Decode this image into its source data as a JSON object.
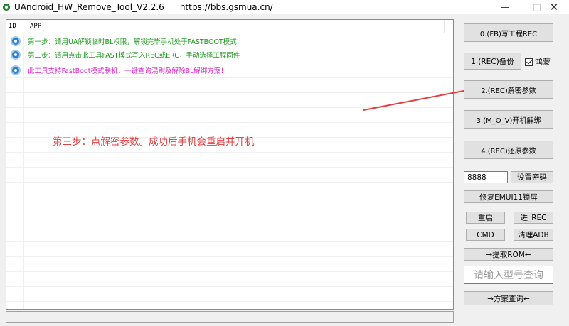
{
  "window": {
    "title": "UAndroid_HW_Remove_Tool_V2.2.6",
    "url": "https://bbs.gsmua.cn/",
    "minimize": "—",
    "maximize": "□",
    "close": "✕"
  },
  "list": {
    "columns": [
      "ID",
      "APP"
    ],
    "rows": [
      {
        "text": "第一步：请用UA解锁临时BL权限，解锁完毕手机处于FASTBOOT模式",
        "color": "#1a9a1a"
      },
      {
        "text": "第二步：请用点击此工具FAST模式写入REC或ERC，手动选择工程固件",
        "color": "#1a9a1a"
      },
      {
        "text": "此工具支持FastBoot模式联机，一键查询混刷及解除BL解绑方案！",
        "color": "#e020d0"
      }
    ]
  },
  "annotation": {
    "text": "第三步：点解密参数。成功后手机会重启并开机",
    "color": "#e04040"
  },
  "buttons": {
    "fb_write_rec": "0.(FB)写工程REC",
    "rec_backup": "1.(REC)备份",
    "hongmeng_label": "鸿蒙",
    "rec_decrypt": "2.(REC)解密参数",
    "mov_unbind": "3.(M_O_V)开机解绑",
    "rec_restore": "4.(REC)还原参数",
    "set_password": "设置密码",
    "fix_emui11": "修复EMUI11锁屏",
    "reboot": "重启",
    "enter_rec": "进_REC",
    "cmd": "CMD",
    "clear_adb": "清理ADB",
    "extract_rom": "→提取ROM←",
    "plan_query": "→方案查询←"
  },
  "inputs": {
    "password_value": "8888",
    "model_query_placeholder": "请输入型号查询"
  },
  "checkbox": {
    "hongmeng_checked": true
  },
  "colors": {
    "accent": "#2f80d0",
    "arrow": "#e04040"
  }
}
